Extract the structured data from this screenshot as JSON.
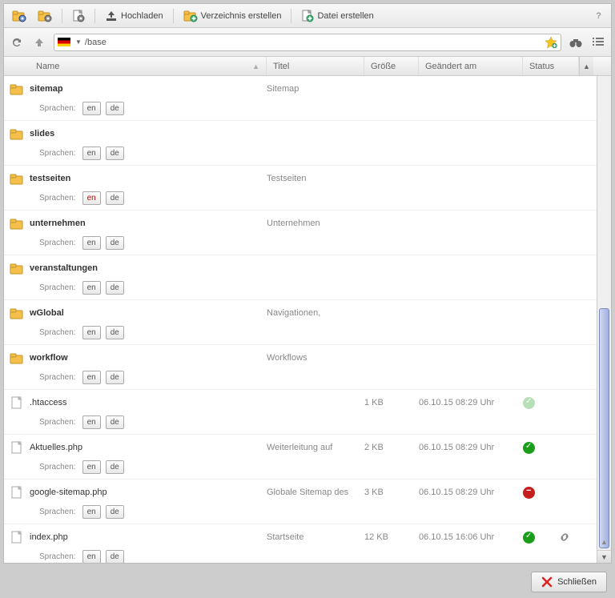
{
  "toolbar": {
    "upload": "Hochladen",
    "create_dir": "Verzeichnis erstellen",
    "create_file": "Datei erstellen"
  },
  "path": "/base",
  "columns": {
    "name": "Name",
    "name_sub": "Sprachen:",
    "title": "Titel",
    "size": "Größe",
    "date": "Geändert am",
    "status": "Status"
  },
  "lang_label": "Sprachen:",
  "lang_en": "en",
  "lang_de": "de",
  "rows": [
    {
      "type": "folder",
      "name": "sitemap",
      "title": "Sitemap",
      "size": "",
      "date": "",
      "status": "",
      "langs": [
        "en",
        "de"
      ],
      "bold": true
    },
    {
      "type": "folder",
      "name": "slides",
      "title": "",
      "size": "",
      "date": "",
      "status": "",
      "langs": [
        "en",
        "de"
      ],
      "bold": true
    },
    {
      "type": "folder",
      "name": "testseiten",
      "title": "Testseiten",
      "size": "",
      "date": "",
      "status": "",
      "langs": [
        "en-red",
        "de"
      ],
      "bold": true
    },
    {
      "type": "folder",
      "name": "unternehmen",
      "title": "Unternehmen",
      "size": "",
      "date": "",
      "status": "",
      "langs": [
        "en",
        "de"
      ],
      "bold": true
    },
    {
      "type": "folder",
      "name": "veranstaltungen",
      "title": "",
      "size": "",
      "date": "",
      "status": "",
      "langs": [
        "en",
        "de"
      ],
      "bold": true
    },
    {
      "type": "folder",
      "name": "wGlobal",
      "title": "Navigationen,",
      "size": "",
      "date": "",
      "status": "",
      "langs": [
        "en",
        "de"
      ],
      "bold": true
    },
    {
      "type": "folder",
      "name": "workflow",
      "title": "Workflows",
      "size": "",
      "date": "",
      "status": "",
      "langs": [
        "en",
        "de"
      ],
      "bold": true
    },
    {
      "type": "file",
      "name": ".htaccess",
      "title": "",
      "size": "1 KB",
      "date": "06.10.15 08:29 Uhr",
      "status": "ok-light",
      "langs": [
        "en",
        "de"
      ],
      "bold": false
    },
    {
      "type": "file",
      "name": "Aktuelles.php",
      "title": "Weiterleitung auf",
      "size": "2 KB",
      "date": "06.10.15 08:29 Uhr",
      "status": "ok",
      "langs": [
        "en",
        "de"
      ],
      "bold": false
    },
    {
      "type": "file",
      "name": "google-sitemap.php",
      "title": "Globale Sitemap des",
      "size": "3 KB",
      "date": "06.10.15 08:29 Uhr",
      "status": "no",
      "langs": [
        "en",
        "de"
      ],
      "bold": false
    },
    {
      "type": "file",
      "name": "index.php",
      "title": "Startseite",
      "size": "12 KB",
      "date": "06.10.15 16:06 Uhr",
      "status": "ok",
      "langs": [
        "en",
        "de"
      ],
      "bold": false,
      "link": true
    }
  ],
  "close": "Schließen"
}
